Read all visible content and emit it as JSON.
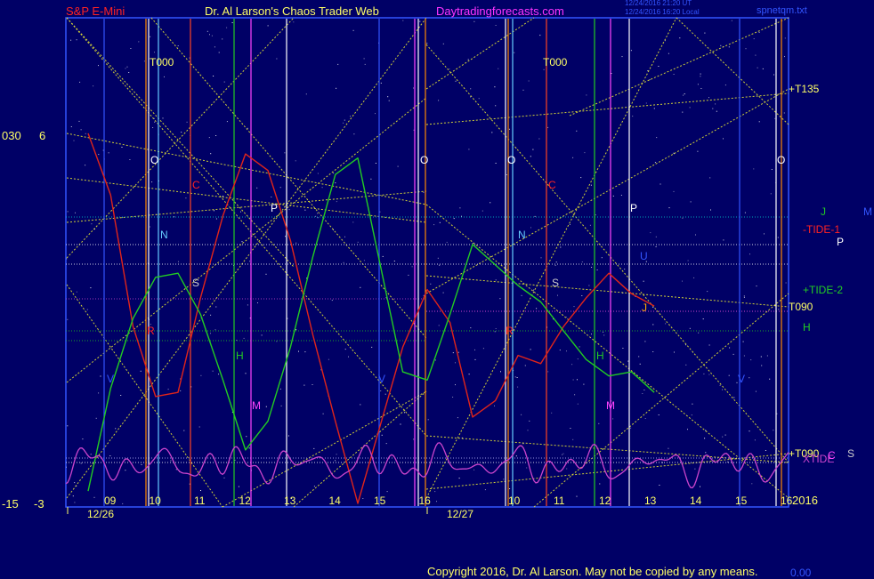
{
  "header": {
    "symbol": "S&P E-Mini",
    "title": "Dr. Al Larson's Chaos Trader Web",
    "site": "Daytradingforecasts.com",
    "timestamp_line1": "12/24/2016 21:20 UT",
    "timestamp_line2": "12/24/2016 16:20 Local",
    "file": "spnetqm.txt"
  },
  "footer": {
    "copyright": "Copyright 2016, Dr. Al Larson. May not be copied by any means.",
    "corner": "0.00"
  },
  "left_scale": {
    "top_a": "030",
    "top_b": "6",
    "bottom_a": "-15",
    "bottom_b": "-3"
  },
  "year_label": "2016",
  "colors": {
    "background": "#000066",
    "price_red": "#e0241a",
    "tide_green": "#22cc22",
    "tide_magenta": "#cc44cc",
    "guide_yellow": "#e6e633",
    "frame_blue": "#3355ff",
    "header_red": "#ff2222",
    "header_yellow": "#ffff66",
    "header_magenta": "#ff33ff"
  },
  "chart_data": {
    "type": "line",
    "title": "S&P E-Mini",
    "x_axis": {
      "dates": [
        "12/26",
        "12/27"
      ],
      "hour_ticks_day1": [
        "09",
        "10",
        "11",
        "12",
        "13",
        "14",
        "15",
        "16"
      ],
      "hour_ticks_day2": [
        "10",
        "11",
        "12",
        "13",
        "14",
        "15",
        "16"
      ]
    },
    "series": [
      {
        "name": "-TIDE-1",
        "color": "#e0241a",
        "points": [
          [
            "09:00",
            6.0
          ],
          [
            "09:30",
            4.5
          ],
          [
            "10:00",
            1.3
          ],
          [
            "10:30",
            -0.4
          ],
          [
            "11:00",
            -0.3
          ],
          [
            "11:30",
            2.0
          ],
          [
            "12:00",
            4.0
          ],
          [
            "12:30",
            5.5
          ],
          [
            "13:00",
            5.1
          ],
          [
            "13:30",
            3.4
          ],
          [
            "14:00",
            1.1
          ],
          [
            "14:30",
            -1.0
          ],
          [
            "15:00",
            -3.0
          ],
          [
            "16:00",
            0.8
          ],
          [
            "16:30",
            2.2
          ],
          [
            "17:00",
            1.4
          ],
          [
            "17:30",
            -0.9
          ],
          [
            "18:00",
            -0.5
          ],
          [
            "18:30",
            0.6
          ],
          [
            "19:00",
            0.4
          ],
          [
            "19:30",
            1.3
          ],
          [
            "20:00",
            2.0
          ],
          [
            "20:30",
            2.6
          ],
          [
            "21:00",
            2.1
          ],
          [
            "21:30",
            1.8
          ]
        ]
      },
      {
        "name": "+TIDE-2",
        "color": "#22cc22",
        "points": [
          [
            "09:00",
            -2.7
          ],
          [
            "09:30",
            -0.2
          ],
          [
            "10:00",
            1.5
          ],
          [
            "10:30",
            2.5
          ],
          [
            "11:00",
            2.6
          ],
          [
            "11:30",
            1.6
          ],
          [
            "12:00",
            0.0
          ],
          [
            "12:30",
            -1.7
          ],
          [
            "13:00",
            -1.0
          ],
          [
            "13:30",
            0.8
          ],
          [
            "14:00",
            3.0
          ],
          [
            "14:30",
            5.0
          ],
          [
            "15:00",
            5.4
          ],
          [
            "16:00",
            0.2
          ],
          [
            "16:30",
            0.0
          ],
          [
            "17:00",
            1.6
          ],
          [
            "17:30",
            3.3
          ],
          [
            "18:00",
            2.8
          ],
          [
            "18:30",
            2.3
          ],
          [
            "19:00",
            1.9
          ],
          [
            "19:30",
            1.2
          ],
          [
            "20:00",
            0.5
          ],
          [
            "20:30",
            0.1
          ],
          [
            "21:00",
            0.2
          ],
          [
            "21:30",
            -0.3
          ]
        ]
      },
      {
        "name": "XTIDE",
        "color": "#cc44cc",
        "type": "oscillator"
      }
    ],
    "vertical_markers": [
      "T000",
      "O",
      "C",
      "N",
      "S",
      "P",
      "R",
      "H",
      "M",
      "V",
      "U",
      "J"
    ],
    "edge_labels": [
      "+T135",
      "J",
      "M",
      "-TIDE-1",
      "P",
      "+TIDE-2",
      "T090",
      "H",
      "+T090",
      "XTIDE",
      "C",
      "S"
    ]
  }
}
